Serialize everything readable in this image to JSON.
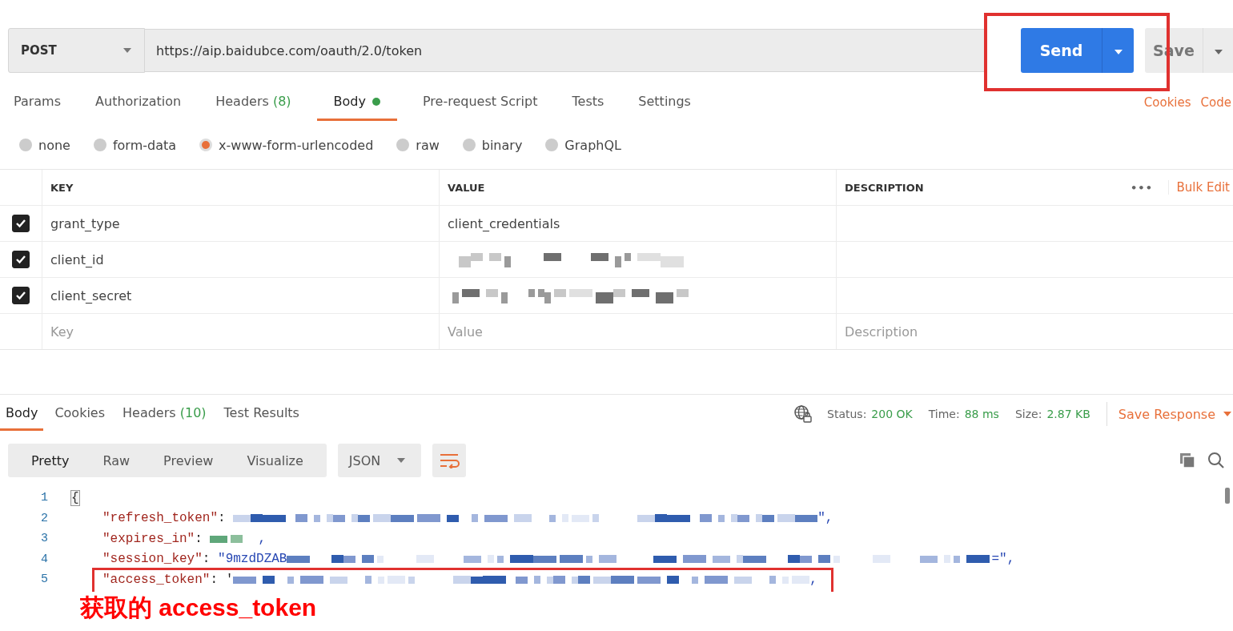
{
  "request": {
    "method": "POST",
    "url": "https://aip.baidubce.com/oauth/2.0/token",
    "send": "Send",
    "save": "Save"
  },
  "request_tabs": [
    {
      "label": "Params",
      "selected": false
    },
    {
      "label": "Authorization",
      "selected": false
    },
    {
      "label": "Headers",
      "count": "(8)",
      "selected": false
    },
    {
      "label": "Body",
      "dot": true,
      "selected": true
    },
    {
      "label": "Pre-request Script",
      "selected": false
    },
    {
      "label": "Tests",
      "selected": false
    },
    {
      "label": "Settings",
      "selected": false
    }
  ],
  "request_links": [
    "Cookies",
    "Code"
  ],
  "body_types": [
    {
      "label": "none",
      "selected": false
    },
    {
      "label": "form-data",
      "selected": false
    },
    {
      "label": "x-www-form-urlencoded",
      "selected": true
    },
    {
      "label": "raw",
      "selected": false
    },
    {
      "label": "binary",
      "selected": false
    },
    {
      "label": "GraphQL",
      "selected": false
    }
  ],
  "params_table": {
    "columns": [
      "KEY",
      "VALUE",
      "DESCRIPTION"
    ],
    "more": "•••",
    "bulk_edit": "Bulk Edit",
    "rows": [
      {
        "checked": true,
        "key": "grant_type",
        "kind": "text",
        "value": "client_credentials"
      },
      {
        "checked": true,
        "key": "client_id",
        "kind": "redacted"
      },
      {
        "checked": true,
        "key": "client_secret",
        "kind": "redacted"
      }
    ],
    "placeholder_row": {
      "key": "Key",
      "value": "Value",
      "description": "Description"
    }
  },
  "response": {
    "tabs": [
      {
        "label": "Body",
        "selected": true
      },
      {
        "label": "Cookies",
        "selected": false
      },
      {
        "label": "Headers",
        "count": "(10)",
        "selected": false
      },
      {
        "label": "Test Results",
        "selected": false
      }
    ],
    "status_label": "Status:",
    "status": "200 OK",
    "time_label": "Time:",
    "time": "88 ms",
    "size_label": "Size:",
    "size": "2.87 KB",
    "save_response": "Save Response",
    "view_modes": [
      {
        "label": "Pretty",
        "selected": true
      },
      {
        "label": "Raw",
        "selected": false
      },
      {
        "label": "Preview",
        "selected": false
      },
      {
        "label": "Visualize",
        "selected": false
      }
    ],
    "format": "JSON",
    "lines": [
      {
        "number": "1",
        "kind": "brace",
        "text": "{"
      },
      {
        "number": "2",
        "kind": "pair",
        "key": "\"refresh_token\"",
        "sep": ": ",
        "redacted": {
          "kind": "string"
        },
        "suffix": "\","
      },
      {
        "number": "3",
        "kind": "pair",
        "key": "\"expires_in\"",
        "sep": ": ",
        "redacted": {
          "kind": "number"
        },
        "suffix": ","
      },
      {
        "number": "4",
        "kind": "pair",
        "key": "\"session_key\"",
        "sep": ": ",
        "prefix": "\"9mzdDZAB",
        "redacted": {
          "kind": "string"
        },
        "suffix": "=\","
      },
      {
        "number": "5",
        "kind": "pair",
        "key": "\"access_token\"",
        "sep": ": '",
        "redacted": {
          "kind": "string"
        },
        "suffix": ","
      }
    ]
  },
  "caption": "获取的 access_token"
}
